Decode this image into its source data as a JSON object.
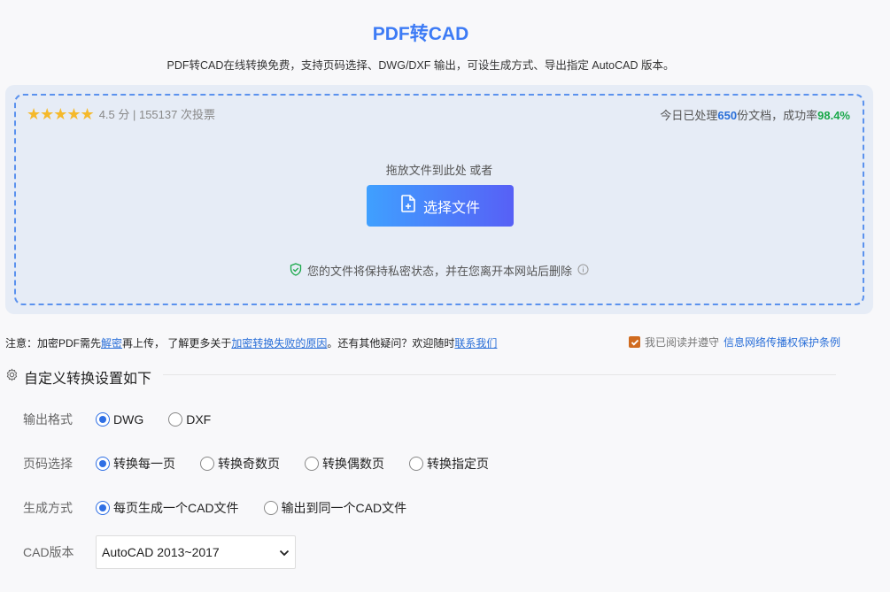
{
  "header": {
    "title": "PDF转CAD",
    "subtitle": "PDF转CAD在线转换免费，支持页码选择、DWG/DXF 输出，可设生成方式、导出指定 AutoCAD 版本。"
  },
  "upload": {
    "rating_text": "4.5 分 | 155137 次投票",
    "stats_prefix": "今日已处理",
    "stats_count": "650",
    "stats_mid": "份文档，成功率",
    "stats_rate": "98.4%",
    "drop_hint": "拖放文件到此处 或者",
    "select_button": "选择文件",
    "privacy_text": "您的文件将保持私密状态，并在您离开本网站后删除"
  },
  "note": {
    "prefix": "注意：加密PDF需先",
    "link1": "解密",
    "mid1": "再上传，  了解更多关于",
    "link2": "加密转换失败的原因",
    "mid2": "。还有其他疑问？欢迎随时",
    "link3": "联系我们"
  },
  "agreement": {
    "text": "我已阅读并遵守",
    "link": "信息网络传播权保护条例"
  },
  "settings": {
    "title": "自定义转换设置如下",
    "output_format": {
      "label": "输出格式",
      "options": [
        "DWG",
        "DXF"
      ]
    },
    "page_select": {
      "label": "页码选择",
      "options": [
        "转换每一页",
        "转换奇数页",
        "转换偶数页",
        "转换指定页"
      ]
    },
    "generate_mode": {
      "label": "生成方式",
      "options": [
        "每页生成一个CAD文件",
        "输出到同一个CAD文件"
      ]
    },
    "cad_version": {
      "label": "CAD版本",
      "selected": "AutoCAD 2013~2017"
    }
  },
  "colors": {
    "accent": "#3d7bf5",
    "success": "#1aa84a",
    "star": "#f5b92b",
    "checkbox": "#d06b1f"
  }
}
